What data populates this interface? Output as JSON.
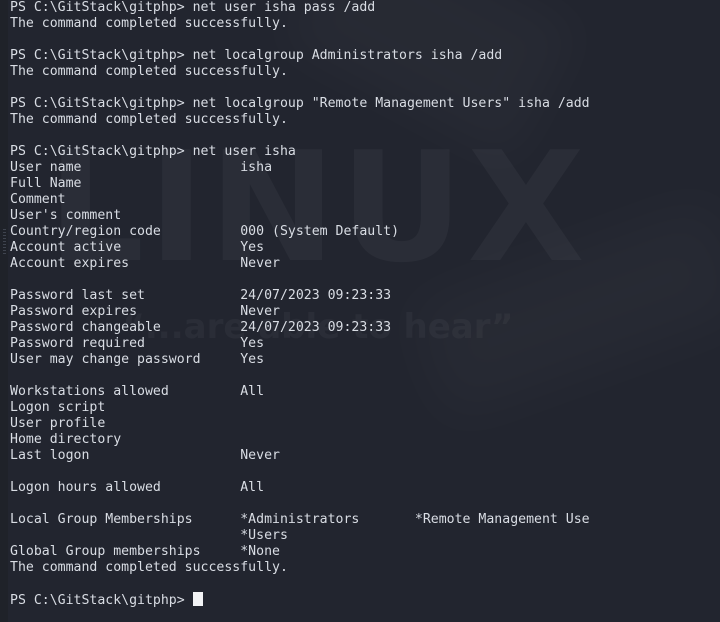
{
  "terminal": {
    "shell": "PowerShell",
    "background_color": "#22252f",
    "foreground_color": "#d9dde4",
    "cursor_color": "#f2f3f5",
    "prompt": "PS C:\\GitStack\\gitphp>",
    "watermark": {
      "word": "LINUX",
      "quote": "“...are able to hear”"
    },
    "lines": [
      "PS C:\\GitStack\\gitphp> net user isha pass /add",
      "The command completed successfully.",
      "",
      "PS C:\\GitStack\\gitphp> net localgroup Administrators isha /add",
      "The command completed successfully.",
      "",
      "PS C:\\GitStack\\gitphp> net localgroup \"Remote Management Users\" isha /add",
      "The command completed successfully.",
      "",
      "PS C:\\GitStack\\gitphp> net user isha",
      "User name                    isha",
      "Full Name",
      "Comment",
      "User's comment",
      "Country/region code          000 (System Default)",
      "Account active               Yes",
      "Account expires              Never",
      "",
      "Password last set            24/07/2023 09:23:33",
      "Password expires             Never",
      "Password changeable          24/07/2023 09:23:33",
      "Password required            Yes",
      "User may change password     Yes",
      "",
      "Workstations allowed         All",
      "Logon script",
      "User profile",
      "Home directory",
      "Last logon                   Never",
      "",
      "Logon hours allowed          All",
      "",
      "Local Group Memberships      *Administrators       *Remote Management Use",
      "                             *Users",
      "Global Group memberships     *None",
      "The command completed successfully.",
      ""
    ],
    "final_prompt": "PS C:\\GitStack\\gitphp> "
  }
}
